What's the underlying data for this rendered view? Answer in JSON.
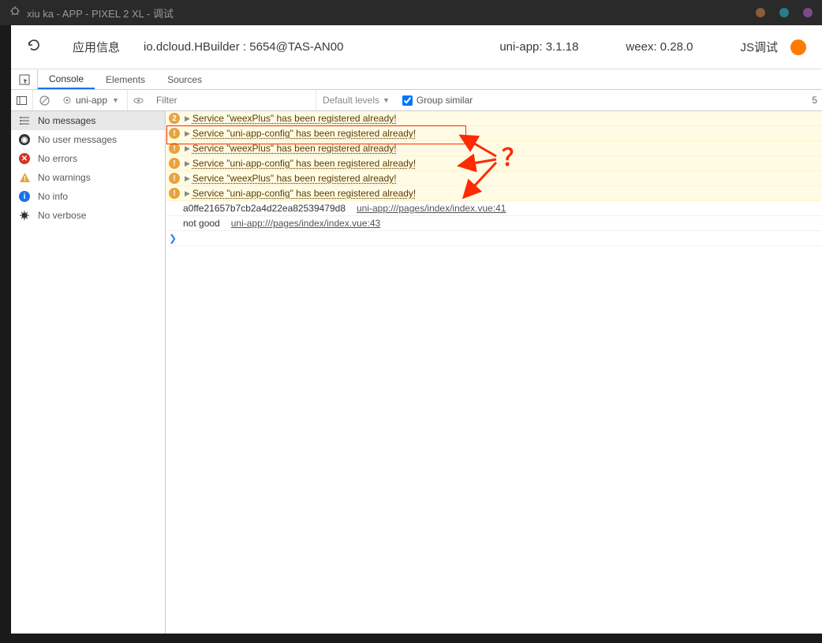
{
  "title": "xiu ka - APP - PIXEL 2 XL - 调试",
  "dots": [
    "#8a5a3a",
    "#2a7a8a",
    "#7a4a8a"
  ],
  "info": {
    "app_info": "应用信息",
    "pkg": "io.dcloud.HBuilder : 5654@TAS-AN00",
    "uni": "uni-app: 3.1.18",
    "weex": "weex: 0.28.0",
    "js_debug": "JS调试"
  },
  "tabs": [
    "Console",
    "Elements",
    "Sources"
  ],
  "filter": {
    "context": "uni-app",
    "placeholder": "Filter",
    "levels": "Default levels",
    "group": "Group similar",
    "hidden": "5"
  },
  "sidebar": [
    {
      "icon": "list",
      "label": "No messages"
    },
    {
      "icon": "user",
      "label": "No user messages"
    },
    {
      "icon": "err",
      "label": "No errors"
    },
    {
      "icon": "warn",
      "label": "No warnings"
    },
    {
      "icon": "info",
      "label": "No info"
    },
    {
      "icon": "bug",
      "label": "No verbose"
    }
  ],
  "logs": [
    {
      "type": "warn",
      "badge": "2",
      "text": "Service \"weexPlus\" has been registered already!"
    },
    {
      "type": "warn",
      "badge": "!",
      "text": "Service \"uni-app-config\" has been registered already!"
    },
    {
      "type": "warn",
      "badge": "!",
      "text": "Service \"weexPlus\" has been registered already!"
    },
    {
      "type": "warn",
      "badge": "!",
      "text": "Service \"uni-app-config\" has been registered already!"
    },
    {
      "type": "warn",
      "badge": "!",
      "text": "Service \"weexPlus\" has been registered already!"
    },
    {
      "type": "warn",
      "badge": "!",
      "text": "Service \"uni-app-config\" has been registered already!"
    },
    {
      "type": "plain",
      "text": "a0ffe21657b7cb2a4d22ea82539479d8",
      "link": "uni-app:///pages/index/index.vue:41"
    },
    {
      "type": "plain",
      "text": "not good",
      "link": "uni-app:///pages/index/index.vue:43"
    },
    {
      "type": "prompt"
    }
  ],
  "annot_q": "？"
}
